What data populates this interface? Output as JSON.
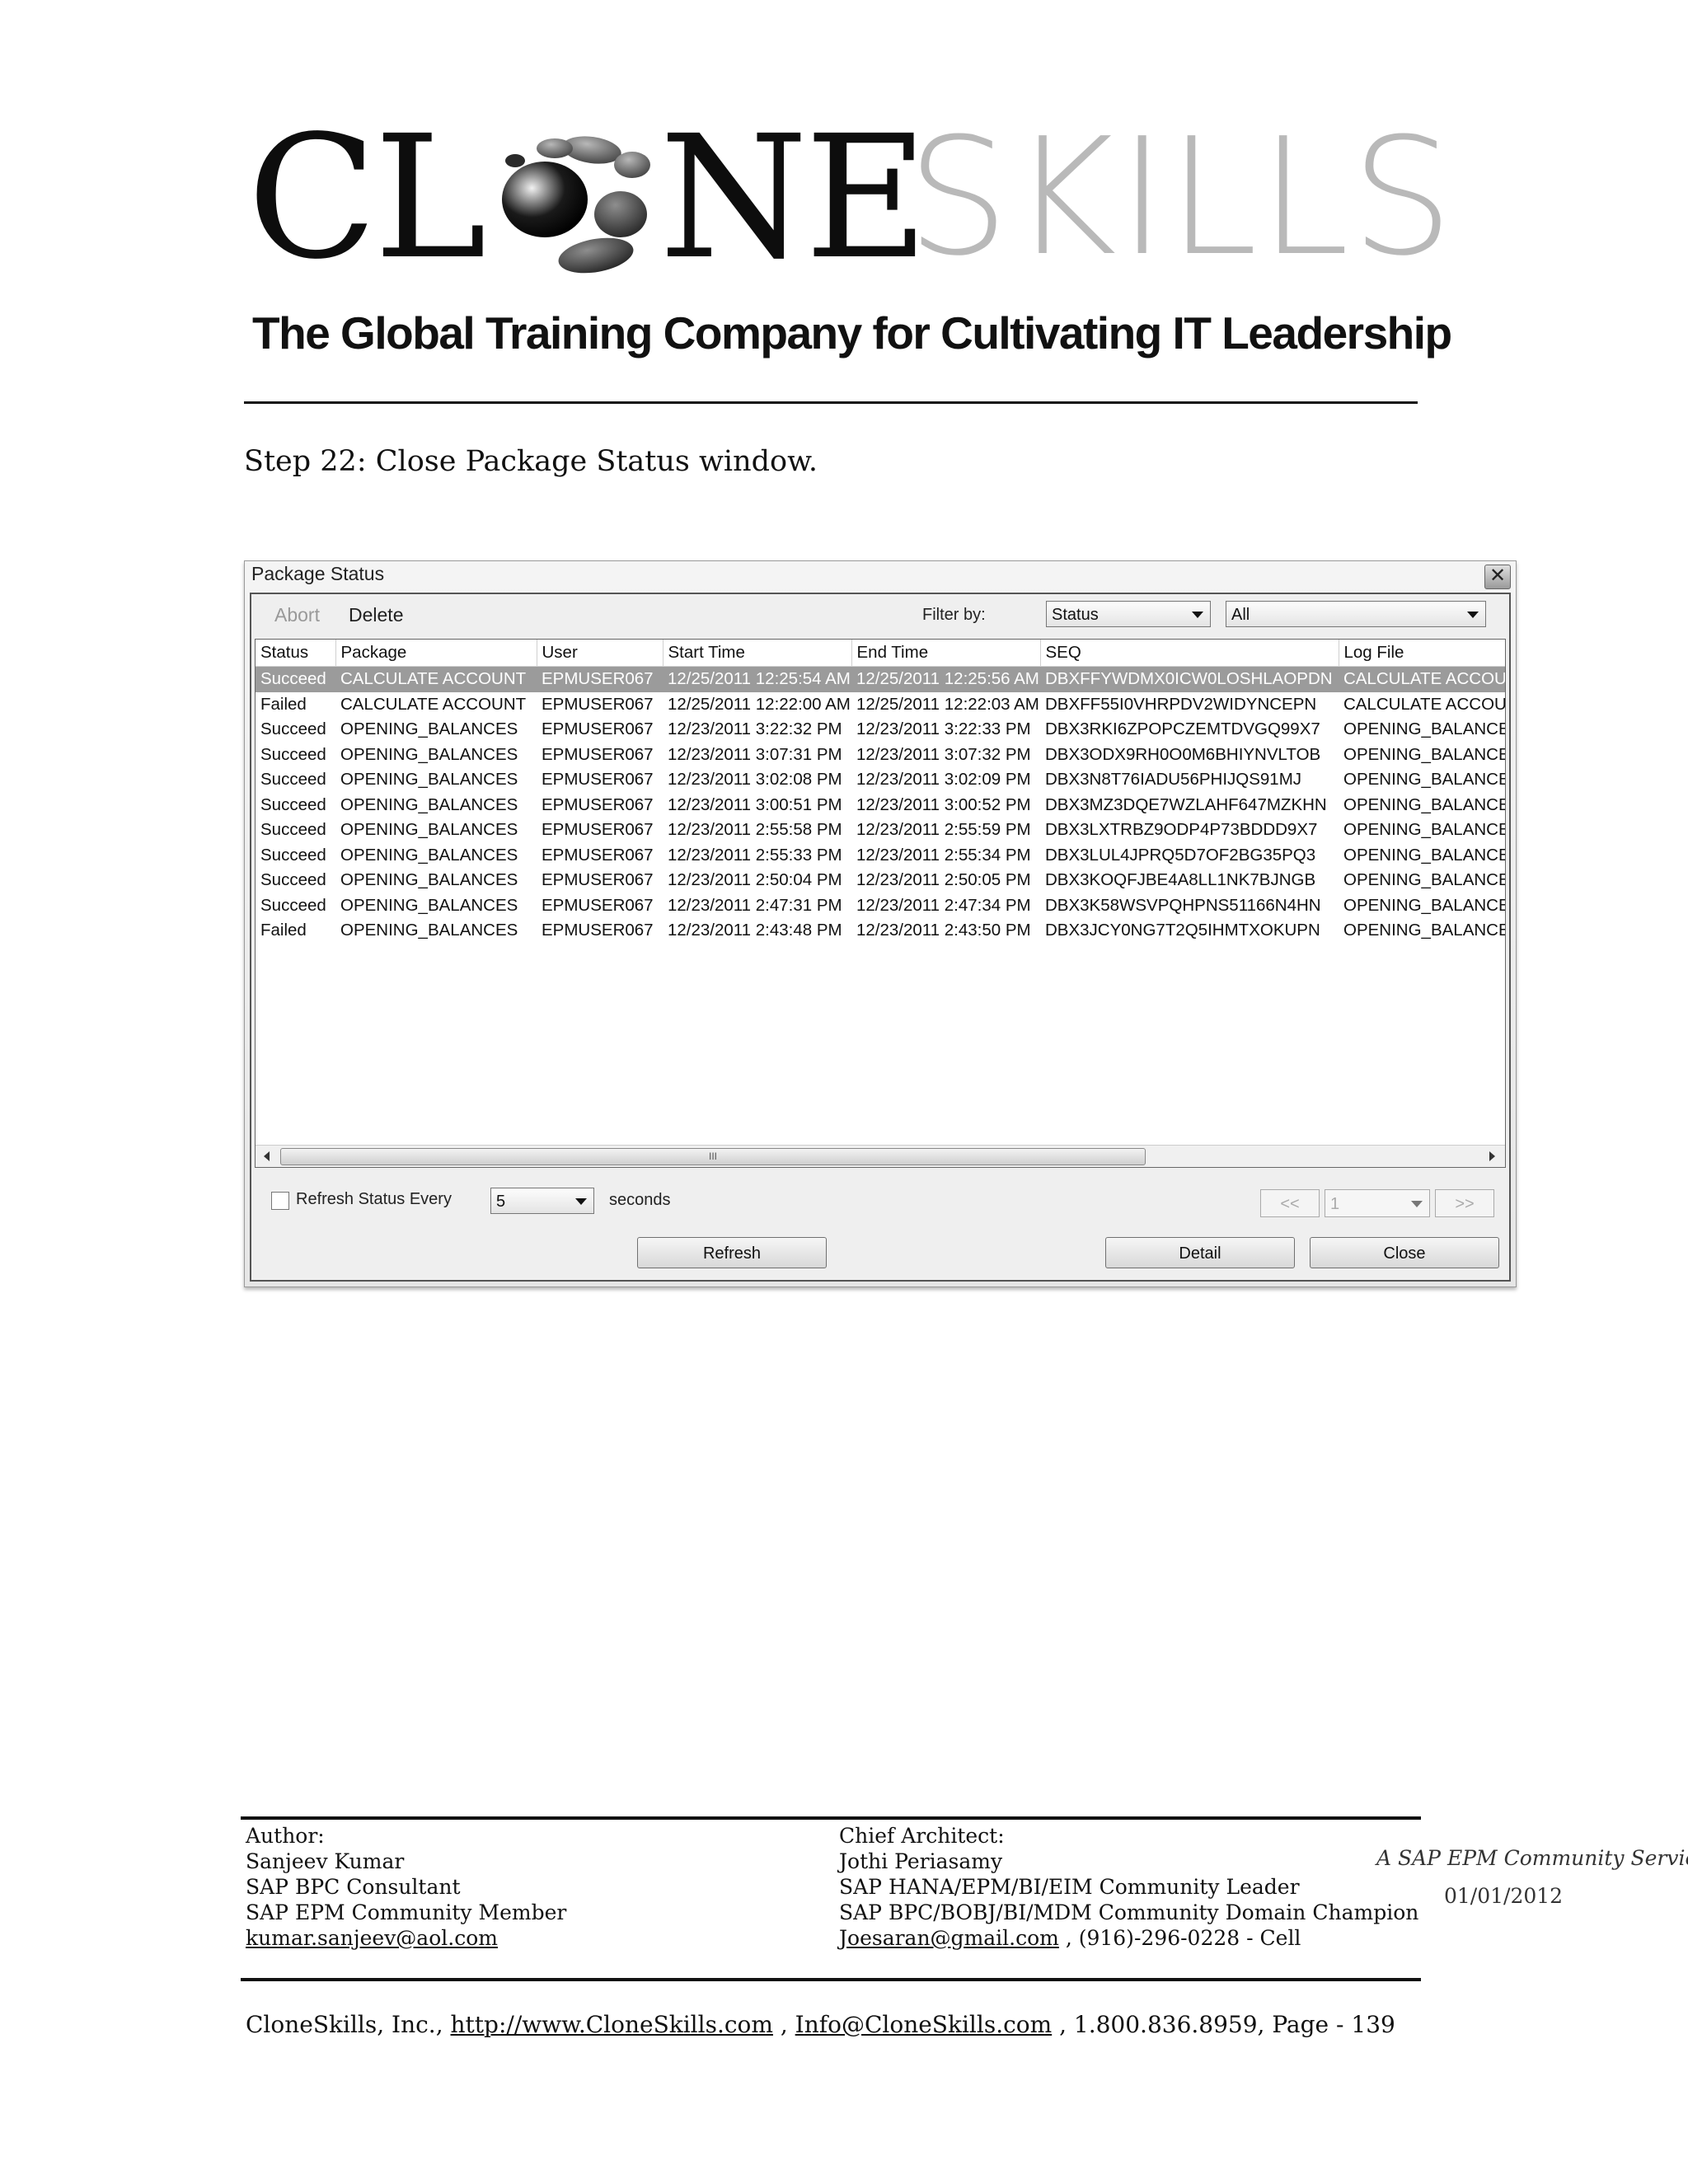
{
  "header": {
    "logo_text_dark": "CL",
    "logo_text_dark2": "NE",
    "logo_text_light": "SKILLS",
    "tagline": "The Global Training Company for Cultivating IT Leadership"
  },
  "step_text": "Step 22: Close Package Status window.",
  "window": {
    "title": "Package Status",
    "close_glyph": "✕",
    "toolbar": {
      "abort_label": "Abort",
      "delete_label": "Delete",
      "filter_label": "Filter by:"
    },
    "filter_field": "Status",
    "filter_value": "All",
    "columns": [
      "Status",
      "Package",
      "User",
      "Start Time",
      "End Time",
      "SEQ",
      "Log File"
    ],
    "rows": [
      [
        "Succeed",
        "CALCULATE ACCOUNT",
        "EPMUSER067",
        "12/25/2011 12:25:54 AM",
        "12/25/2011 12:25:56 AM",
        "DBXFFYWDMX0ICW0LOSHLAOPDN",
        "CALCULATE ACCOUNT"
      ],
      [
        "Failed",
        "CALCULATE ACCOUNT",
        "EPMUSER067",
        "12/25/2011 12:22:00 AM",
        "12/25/2011 12:22:03 AM",
        "DBXFF55I0VHRPDV2WIDYNCEPN",
        "CALCULATE ACCOUNT"
      ],
      [
        "Succeed",
        "OPENING_BALANCES",
        "EPMUSER067",
        "12/23/2011 3:22:32 PM",
        "12/23/2011 3:22:33 PM",
        "DBX3RKI6ZPOPCZEMTDVGQ99X7",
        "OPENING_BALANCES"
      ],
      [
        "Succeed",
        "OPENING_BALANCES",
        "EPMUSER067",
        "12/23/2011 3:07:31 PM",
        "12/23/2011 3:07:32 PM",
        "DBX3ODX9RH0O0M6BHIYNVLTOB",
        "OPENING_BALANCES"
      ],
      [
        "Succeed",
        "OPENING_BALANCES",
        "EPMUSER067",
        "12/23/2011 3:02:08 PM",
        "12/23/2011 3:02:09 PM",
        "DBX3N8T76IADU56PHIJQS91MJ",
        "OPENING_BALANCES"
      ],
      [
        "Succeed",
        "OPENING_BALANCES",
        "EPMUSER067",
        "12/23/2011 3:00:51 PM",
        "12/23/2011 3:00:52 PM",
        "DBX3MZ3DQE7WZLAHF647MZKHN",
        "OPENING_BALANCES"
      ],
      [
        "Succeed",
        "OPENING_BALANCES",
        "EPMUSER067",
        "12/23/2011 2:55:58 PM",
        "12/23/2011 2:55:59 PM",
        "DBX3LXTRBZ9ODP4P73BDDD9X7",
        "OPENING_BALANCES"
      ],
      [
        "Succeed",
        "OPENING_BALANCES",
        "EPMUSER067",
        "12/23/2011 2:55:33 PM",
        "12/23/2011 2:55:34 PM",
        "DBX3LUL4JPRQ5D7OF2BG35PQ3",
        "OPENING_BALANCES"
      ],
      [
        "Succeed",
        "OPENING_BALANCES",
        "EPMUSER067",
        "12/23/2011 2:50:04 PM",
        "12/23/2011 2:50:05 PM",
        "DBX3KOQFJBE4A8LL1NK7BJNGB",
        "OPENING_BALANCES"
      ],
      [
        "Succeed",
        "OPENING_BALANCES",
        "EPMUSER067",
        "12/23/2011 2:47:31 PM",
        "12/23/2011 2:47:34 PM",
        "DBX3K58WSVPQHPNS51166N4HN",
        "OPENING_BALANCES"
      ],
      [
        "Failed",
        "OPENING_BALANCES",
        "EPMUSER067",
        "12/23/2011 2:43:48 PM",
        "12/23/2011 2:43:50 PM",
        "DBX3JCY0NG7T2Q5IHMTXOKUPN",
        "OPENING_BALANCES"
      ]
    ],
    "selected_row": 0,
    "scrollbar_grip": "III",
    "refresh_label": "Refresh Status Every",
    "refresh_checked": false,
    "refresh_interval": "5",
    "seconds_label": "seconds",
    "page_prev": "<<",
    "page_number": "1",
    "page_next": ">>",
    "refresh_button": "Refresh",
    "detail_button": "Detail",
    "close_button": "Close"
  },
  "footer": {
    "author_heading": "Author:",
    "author_name": "Sanjeev Kumar",
    "author_role1": "SAP BPC Consultant",
    "author_role2": "SAP EPM Community Member",
    "author_email": "kumar.sanjeev@aol.com",
    "architect_heading": "Chief Architect:",
    "architect_name": "Jothi Periasamy",
    "architect_role1": "SAP HANA/EPM/BI/EIM Community Leader",
    "architect_role2": "SAP BPC/BOBJ/BI/MDM Community Domain Champion",
    "architect_email": "Joesaran@gmail.com",
    "architect_phone": " , (916)-296-0228 - Cell",
    "service": "A SAP EPM Community Service",
    "date": "01/01/2012",
    "company_prefix": "CloneSkills, Inc., ",
    "website": "http://www.CloneSkills.com",
    "sep1": " , ",
    "info_email": "Info@CloneSkills.com",
    "phone_page": " , 1.800.836.8959, Page - 139"
  }
}
